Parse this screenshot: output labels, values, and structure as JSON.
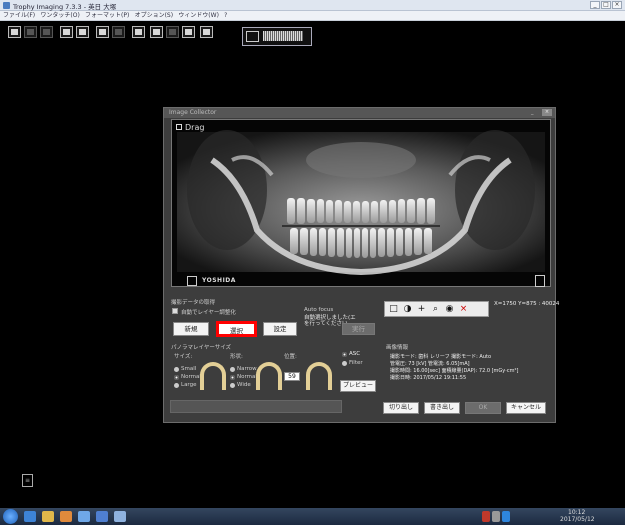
{
  "window": {
    "title": "Trophy Imaging 7.3.3 - 英日 大塚"
  },
  "menu": [
    "ファイル(F)",
    "ワンタッチ(O)",
    "フォーマット(P)",
    "オプション(S)",
    "ウィンドウ(W)",
    "?"
  ],
  "dialog": {
    "title": "Image Collector",
    "drag_label": "Drag",
    "xray_brand": "YOSHIDA",
    "section_title": "撮影データの取得",
    "checkbox_label": "自動でレイヤー調整化",
    "buttons": {
      "new": "新規",
      "select": "選択",
      "settings": "設定",
      "run": "実行"
    },
    "autofocus_title": "Auto focus",
    "autofocus_text": [
      "自動選択しました(エ",
      "を行ってください"
    ],
    "layer_title": "パノラマレイヤーサイズ",
    "size_label": "サイズ:",
    "shape_label": "形状:",
    "position_label": "位置:",
    "size_options": [
      "Small",
      "Normal",
      "Large"
    ],
    "shape_options": [
      "Narrow",
      "Normal",
      "Wide"
    ],
    "position_value": "59",
    "filter_options": [
      "ASC",
      "Filter"
    ],
    "preview_button": "プレビュー",
    "coords": "X=1750 Y=875 : 40024",
    "info_title": "画像情報",
    "info_lines": [
      "撮影モード: 歯科 レリーフ   撮影モード: Auto",
      "管電圧: 73 [kV]        管電流: 6.05[mA]",
      "撮影時間: 16.00[sec]    面積線量(DAP): 72.0 [mGy·cm²]",
      "撮影日時: 2017/05/12 19:11:55"
    ],
    "footer_buttons": {
      "crop": "切り出し",
      "export": "書き出し",
      "ok": "OK",
      "cancel": "キャンセル"
    }
  },
  "taskbar": {
    "clock": "10:12",
    "date": "2017/05/12"
  },
  "colors": {
    "highlight": "#ff0000",
    "arch": "#e3cf96",
    "dialog_bg": "#3d3d3d"
  }
}
